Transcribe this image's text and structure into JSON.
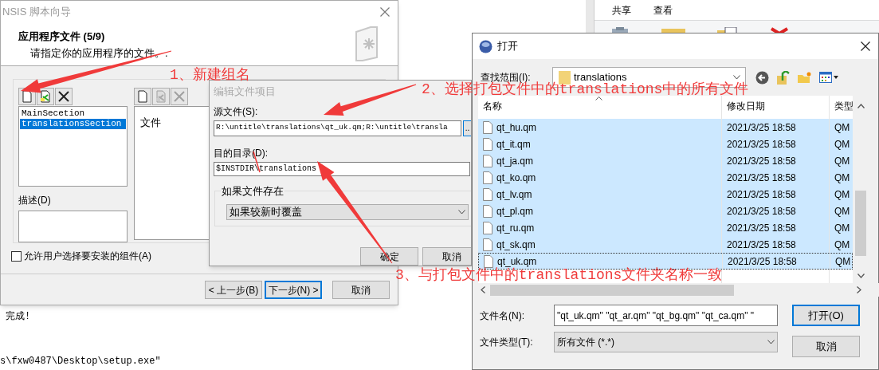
{
  "console": {
    "lines": [
      "完成!",
      "s\\fxw0487\\Desktop\\setup.exe\""
    ]
  },
  "explorer": {
    "tabs": [
      "共享",
      "查看"
    ]
  },
  "wizard": {
    "title": "NSIS 脚本向导",
    "heading": "应用程序文件 (5/9)",
    "subheading": "请指定你的应用程序的文件。.",
    "toolbar_left": [
      {
        "kind": "new",
        "disabled": false
      },
      {
        "kind": "edit",
        "disabled": false
      },
      {
        "kind": "delete",
        "disabled": false
      }
    ],
    "sections": [
      {
        "label": "MainSecetion",
        "selected": false
      },
      {
        "label": "translationsSection",
        "selected": true
      }
    ],
    "description_label": "描述(D)",
    "toolbar_right": [
      {
        "kind": "new",
        "disabled": false
      },
      {
        "kind": "edit",
        "disabled": true
      },
      {
        "kind": "delete",
        "disabled": true
      }
    ],
    "files": [
      "文件"
    ],
    "checkbox": {
      "label": "允许用户选择要安装的组件(A)",
      "checked": false
    },
    "buttons": [
      {
        "label": "< 上一步(B)",
        "default": false
      },
      {
        "label": "下一步(N) >",
        "default": true
      },
      {
        "label": "取消",
        "default": false
      }
    ]
  },
  "edit_dialog": {
    "title": "编辑文件项目",
    "source_label": "源文件(S):",
    "source_value": "R:\\untitle\\translations\\qt_uk.qm;R:\\untitle\\transla",
    "browse": "..",
    "dest_label": "目的目录(D):",
    "dest_value": "$INSTDIR\\translations",
    "group_label": "如果文件存在",
    "overwrite": "如果较新时覆盖",
    "buttons": [
      {
        "label": "确定",
        "default": false
      },
      {
        "label": "取消",
        "default": false
      }
    ]
  },
  "open_dialog": {
    "title": "打开",
    "look_in_label": "查找范围(I):",
    "look_in": "translations",
    "columns": [
      "名称",
      "修改日期",
      "类型"
    ],
    "rows": [
      {
        "name": "qt_hu.qm",
        "date": "2021/3/25 18:58",
        "type": "QM",
        "selected": true
      },
      {
        "name": "qt_it.qm",
        "date": "2021/3/25 18:58",
        "type": "QM",
        "selected": true
      },
      {
        "name": "qt_ja.qm",
        "date": "2021/3/25 18:58",
        "type": "QM",
        "selected": true
      },
      {
        "name": "qt_ko.qm",
        "date": "2021/3/25 18:58",
        "type": "QM",
        "selected": true
      },
      {
        "name": "qt_lv.qm",
        "date": "2021/3/25 18:58",
        "type": "QM",
        "selected": true
      },
      {
        "name": "qt_pl.qm",
        "date": "2021/3/25 18:58",
        "type": "QM",
        "selected": true
      },
      {
        "name": "qt_ru.qm",
        "date": "2021/3/25 18:58",
        "type": "QM",
        "selected": true
      },
      {
        "name": "qt_sk.qm",
        "date": "2021/3/25 18:58",
        "type": "QM",
        "selected": true
      },
      {
        "name": "qt_uk.qm",
        "date": "2021/3/25 18:58",
        "type": "QM",
        "selected": true
      }
    ],
    "filename_label": "文件名(N):",
    "filename": "\"qt_uk.qm\" \"qt_ar.qm\" \"qt_bg.qm\" \"qt_ca.qm\" \"",
    "filetype_label": "文件类型(T):",
    "filetype": "所有文件 (*.*)",
    "buttons": [
      {
        "label": "打开(O)",
        "default": true
      },
      {
        "label": "取消",
        "default": false
      }
    ]
  },
  "annotations": [
    {
      "text": "1、新建组名"
    },
    {
      "text": "2、选择打包文件中的translations中的所有文件"
    },
    {
      "text": "3、与打包文件中的translations文件夹名称一致"
    }
  ]
}
